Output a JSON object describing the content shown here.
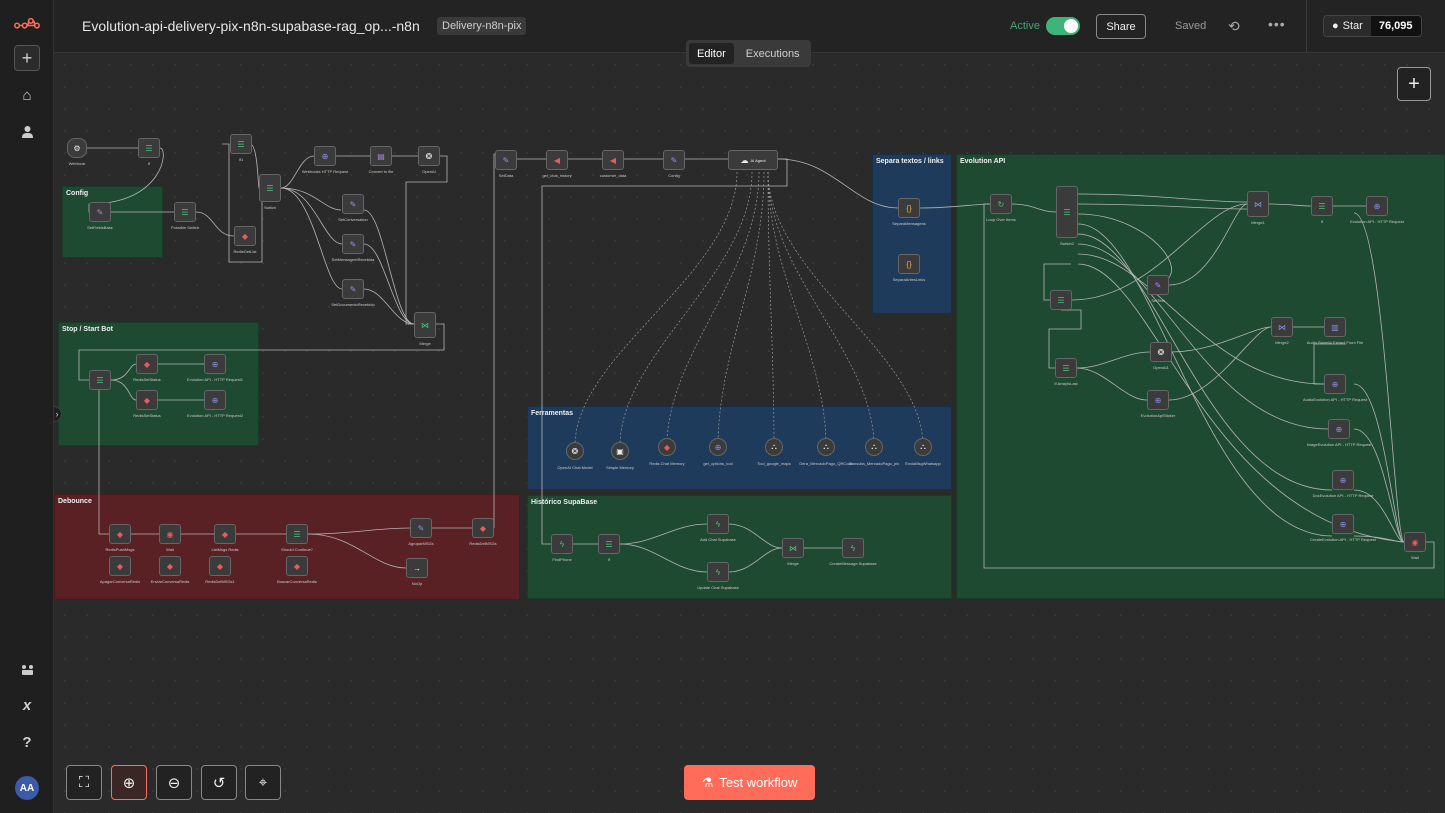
{
  "app": {
    "brand_color": "#ff6d5a"
  },
  "header": {
    "title": "Evolution-api-delivery-pix-n8n-supabase-rag_op...-n8n",
    "tag": "Delivery-n8n-pix",
    "active_label": "Active",
    "share_label": "Share",
    "saved_label": "Saved",
    "github_star_label": "Star",
    "github_star_count": "76,095"
  },
  "modes": {
    "editor": "Editor",
    "executions": "Executions"
  },
  "sidebar": {
    "avatar_initials": "AA"
  },
  "stickies": {
    "config": "Config",
    "stop_start": "Stop / Start Bot",
    "debounce": "Debounce",
    "ferramentas": "Ferramentas",
    "historico": "Histórico SupaBase",
    "separa": "Separa textos / links",
    "evolution": "Evolution API"
  },
  "nodes": {
    "webhook": "Webhook",
    "if1": "If",
    "set_fields": "SetFieldsBase",
    "possible_switch": "Possible Switch",
    "if2": "If1",
    "switch": "Switch",
    "redis_get": "RedisGetList",
    "http": "Webhooks HTTP Request",
    "convert": "Convert to file",
    "openai": "OpenAI",
    "set_conversation": "SetConversation",
    "set_mensagem": "SetMensagemRecebida",
    "set_documento": "SetDocumentoRecebido",
    "merge": "Merge",
    "set_data": "SetData",
    "get_chat": "get_chat_history",
    "customer": "customer_data",
    "config": "Config",
    "ai_agent": "AI Agent",
    "remove_status": "RedisSetStatus",
    "evolution_api1": "Evolution API - HTTP Request1",
    "redis_set": "RedisSetStatus",
    "evolution_api2": "Evolution API - HTTP Request2",
    "redis_push": "RedisPushMsgs",
    "wait": "Wait",
    "list_msgs": "ListMsgs Redis",
    "should_continue": "Should Continue?",
    "agrupar": "AgruparMSGs",
    "redis_del": "RedisDelMSGs",
    "no_op": "NoOp",
    "apagar": "ApagarConversaRedis",
    "enviar_conv": "EnviarConversaRedis",
    "redis_del2": "RedisDelMSGs1",
    "buscar": "BuscarConversaRedis",
    "openai_chat": "OpenAI Chat Model",
    "simple_memory": "Simple Memory",
    "redis_memory": "Redis Chat Memory",
    "get_options": "get_options_tool",
    "tool_google": "Tool_google_maps",
    "gera_pix": "Gera_MercadoPago_QRCode",
    "consulta_pix": "Consulta_MercadoPago_pix",
    "envia_msg": "EnviaMsgWhatsapp",
    "find_phone": "FindPhone",
    "if_sup": "If",
    "add_chat": "Add Chat Supabase",
    "update_chat": "Update Chat Supabase",
    "merge_sup": "Merge",
    "create_msg": "CreateMessage Supabase",
    "code1": "SeparaMensagens",
    "code2": "SeparaAntesLinks",
    "loop": "Loop Over Items",
    "switch2": "Switch2",
    "merge2": "Merge1",
    "if_ev": "If",
    "set_text": "SetText",
    "if_ev2": "If ArrayIsLast",
    "openai2": "OpenAI1",
    "evolution_sticker": "EvolutionApiSticker",
    "merge3": "Merge2",
    "audio_convert": "Audio Base64 Extract From File",
    "evolution_http": "Evolution API - HTTP Request",
    "audio_evo": "AudioEvolution API - HTTP Request",
    "image_evo": "ImageEvolution API - HTTP Request",
    "doc_evo": "DocEvolution API - HTTP Request",
    "create_evo": "CreateEvolution API - HTTP Request",
    "wait2": "Wait"
  },
  "controls": {
    "test_workflow": "Test workflow"
  }
}
